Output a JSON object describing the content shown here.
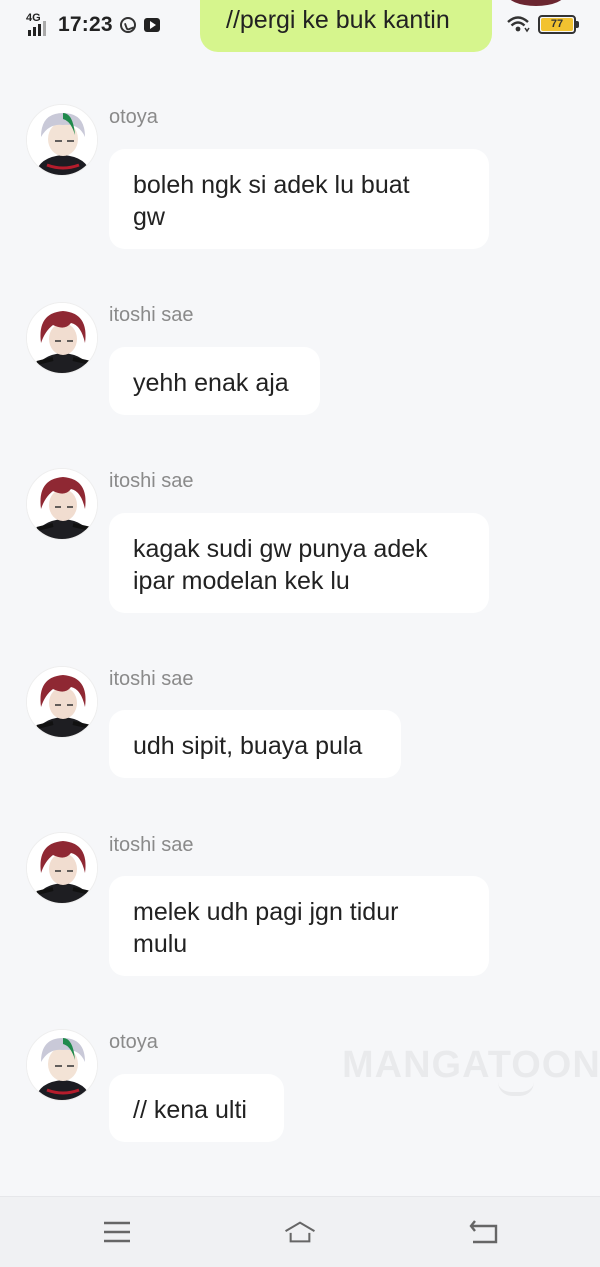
{
  "status_bar": {
    "network": "4G",
    "time": "17:23",
    "battery": "77",
    "icons": [
      "signal-icon",
      "whatsapp-icon",
      "youtube-icon",
      "wifi-icon",
      "battery-icon"
    ]
  },
  "top_message": {
    "text": "//pergi ke buk kantin"
  },
  "messages": [
    {
      "sender": "otoya",
      "text_lines": [
        "boleh ngk si adek lu buat",
        "gw"
      ]
    },
    {
      "sender": "itoshi sae",
      "text_lines": [
        "yehh enak aja"
      ]
    },
    {
      "sender": "itoshi sae",
      "text_lines": [
        "kagak sudi gw punya adek",
        "ipar modelan kek lu"
      ]
    },
    {
      "sender": "itoshi sae",
      "text_lines": [
        "udh sipit, buaya pula"
      ]
    },
    {
      "sender": "itoshi sae",
      "text_lines": [
        "melek udh pagi jgn tidur",
        "mulu"
      ]
    },
    {
      "sender": "otoya",
      "text_lines": [
        "// kena ulti"
      ]
    }
  ],
  "watermark": "MANGATOON",
  "nav_bar": {
    "icons": [
      "menu-icon",
      "home-icon",
      "back-icon"
    ]
  },
  "colors": {
    "background": "#f6f7f9",
    "bubble": "#ffffff",
    "sent_bubble": "#d6f58d",
    "sender_text": "#8a8a8a",
    "battery": "#f2c230"
  }
}
